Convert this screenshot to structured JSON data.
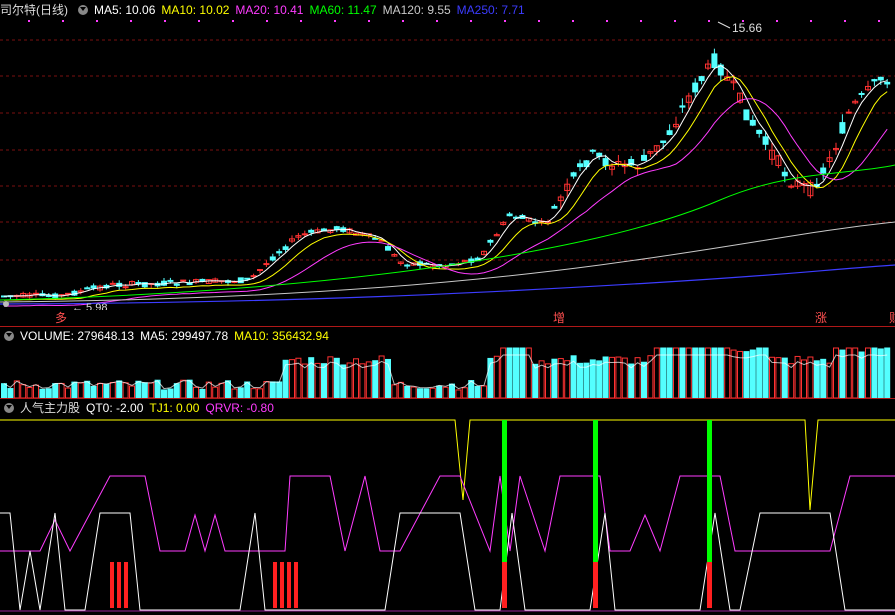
{
  "price_panel": {
    "title": "司尔特(日线)",
    "ma_labels": [
      {
        "text": "MA5: 10.06",
        "color": "#ffffff"
      },
      {
        "text": "MA10: 10.02",
        "color": "#ffff00"
      },
      {
        "text": "MA20: 10.41",
        "color": "#ff3cff"
      },
      {
        "text": "MA60: 11.47",
        "color": "#00ff00"
      },
      {
        "text": "MA120: 9.55",
        "color": "#c8c8c8"
      },
      {
        "text": "MA250: 7.71",
        "color": "#3c3cff"
      }
    ],
    "high_label": "15.66",
    "low_label": "5.98",
    "signals": [
      "多",
      "增",
      "涨",
      "财"
    ]
  },
  "volume_panel": {
    "labels": [
      {
        "text": "VOLUME: 279648.13",
        "color": "#ffffff"
      },
      {
        "text": "MA5: 299497.78",
        "color": "#ffffff"
      },
      {
        "text": "MA10: 356432.94",
        "color": "#ffff00"
      }
    ]
  },
  "indicator_panel": {
    "title": "人气主力股",
    "labels": [
      {
        "text": "QT0: -2.00",
        "color": "#ffffff"
      },
      {
        "text": "TJ1: 0.00",
        "color": "#ffff00"
      },
      {
        "text": "QRVR: -0.80",
        "color": "#ff3cff"
      }
    ]
  },
  "colors": {
    "up": "#ff3232",
    "down": "#54ffff",
    "ma5": "#ffffff",
    "ma10": "#ffff00",
    "ma20": "#ff3cff",
    "ma60": "#00ff00",
    "ma120": "#c8c8c8",
    "ma250": "#3c3cff"
  }
}
